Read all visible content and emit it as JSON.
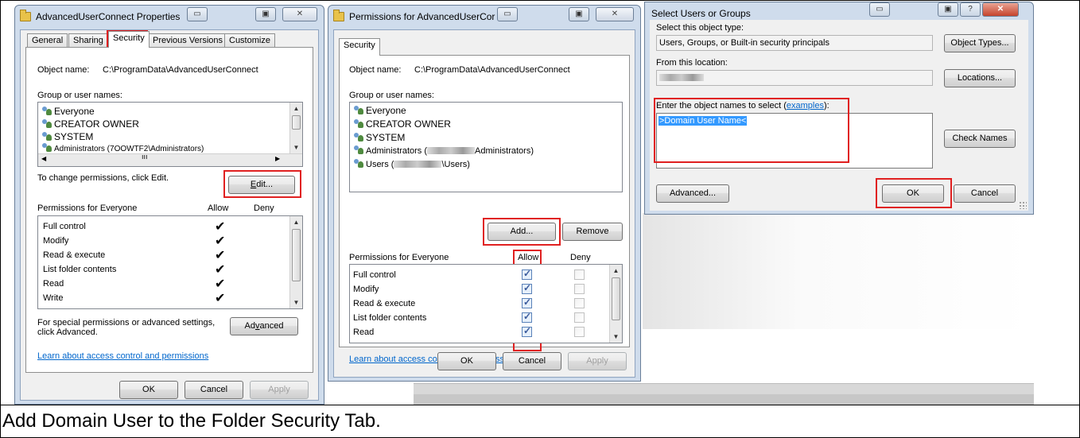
{
  "caption": "Add Domain User to the Folder Security Tab.",
  "props_window": {
    "title": "AdvancedUserConnect Properties",
    "tabs": [
      "General",
      "Sharing",
      "Security",
      "Previous Versions",
      "Customize"
    ],
    "object_name_label": "Object name:",
    "object_name_value": "C:\\ProgramData\\AdvancedUserConnect",
    "group_label": "Group or user names:",
    "users": [
      "Everyone",
      "CREATOR OWNER",
      "SYSTEM",
      "Administrators (7OOWTF2\\Administrators)"
    ],
    "change_text": "To change permissions, click Edit.",
    "edit_button": "Edit...",
    "perm_label": "Permissions for Everyone",
    "allow_col": "Allow",
    "deny_col": "Deny",
    "permissions": [
      "Full control",
      "Modify",
      "Read & execute",
      "List folder contents",
      "Read",
      "Write"
    ],
    "special_text_1": "For special permissions or advanced settings,",
    "special_text_2": "click Advanced.",
    "advanced_button": "Advanced",
    "learn_link": "Learn about access control and permissions",
    "ok": "OK",
    "cancel": "Cancel",
    "apply": "Apply"
  },
  "perm_window": {
    "title": "Permissions for AdvancedUserCor",
    "tab": "Security",
    "object_name_label": "Object name:",
    "object_name_value": "C:\\ProgramData\\AdvancedUserConnect",
    "group_label": "Group or user names:",
    "user_1": "Everyone",
    "user_2": "CREATOR OWNER",
    "user_3": "SYSTEM",
    "admins_prefix": "Administrators (",
    "admins_suffix": "Administrators)",
    "users_prefix": "Users (",
    "users_suffix": "\\Users)",
    "add_button": "Add...",
    "remove_button": "Remove",
    "perm_label": "Permissions for Everyone",
    "allow_col": "Allow",
    "deny_col": "Deny",
    "permissions": [
      "Full control",
      "Modify",
      "Read & execute",
      "List folder contents",
      "Read"
    ],
    "learn_link": "Learn about access control and permissions",
    "ok": "OK",
    "cancel": "Cancel",
    "apply": "Apply"
  },
  "select_window": {
    "title": "Select Users or Groups",
    "object_type_label": "Select this object type:",
    "object_type_value": "Users, Groups, or Built-in security principals",
    "object_types_button": "Object Types...",
    "location_label": "From this location:",
    "locations_button": "Locations...",
    "enter_label_prefix": "Enter the object names to select (",
    "enter_label_link": "examples",
    "enter_label_suffix": "):",
    "entered_value": ">Domain User Name<",
    "check_names_button": "Check Names",
    "advanced_button": "Advanced...",
    "ok": "OK",
    "cancel": "Cancel"
  }
}
